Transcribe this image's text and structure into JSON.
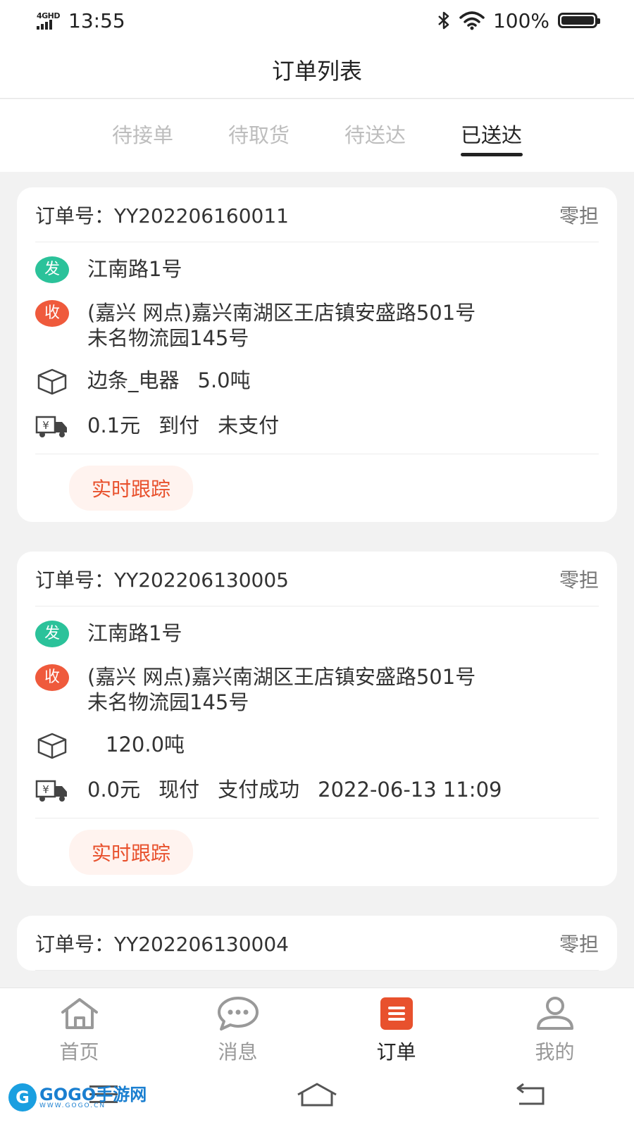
{
  "status_bar": {
    "network": "4GHD",
    "time": "13:55",
    "battery": "100%",
    "icons": [
      "bluetooth-icon",
      "wifi-icon",
      "battery-icon"
    ]
  },
  "header": {
    "title": "订单列表"
  },
  "tabs": [
    {
      "label": "待接单",
      "active": false
    },
    {
      "label": "待取货",
      "active": false
    },
    {
      "label": "待送达",
      "active": false
    },
    {
      "label": "已送达",
      "active": true
    }
  ],
  "orders": [
    {
      "order_no": "订单号：YY202206160011",
      "type": "零担",
      "send_badge": "发",
      "send_addr": "江南路1号",
      "recv_badge": "收",
      "recv_addr_line1": "(嘉兴 网点)嘉兴南湖区王店镇安盛路501号",
      "recv_addr_line2": "未名物流园145号",
      "cargo_name": "边条_电器",
      "cargo_weight": "5.0吨",
      "fee": "0.1元",
      "pay_method": "到付",
      "pay_status": "未支付",
      "pay_time": "",
      "track_label": "实时跟踪"
    },
    {
      "order_no": "订单号：YY202206130005",
      "type": "零担",
      "send_badge": "发",
      "send_addr": "江南路1号",
      "recv_badge": "收",
      "recv_addr_line1": "(嘉兴 网点)嘉兴南湖区王店镇安盛路501号",
      "recv_addr_line2": "未名物流园145号",
      "cargo_name": "",
      "cargo_weight": "120.0吨",
      "fee": "0.0元",
      "pay_method": "现付",
      "pay_status": "支付成功",
      "pay_time": "2022-06-13 11:09",
      "track_label": "实时跟踪"
    },
    {
      "order_no": "订单号：YY202206130004",
      "type": "零担"
    }
  ],
  "bottom_nav": [
    {
      "label": "首页",
      "icon": "home-icon",
      "active": false
    },
    {
      "label": "消息",
      "icon": "message-icon",
      "active": false
    },
    {
      "label": "订单",
      "icon": "order-icon",
      "active": true
    },
    {
      "label": "我的",
      "icon": "profile-icon",
      "active": false
    }
  ],
  "watermark": {
    "main": "GOGO手游网",
    "sub": "WWW.GOGO.CN",
    "letter": "G"
  },
  "colors": {
    "send_badge": "#2bc29a",
    "recv_badge": "#ef5a3c",
    "accent": "#e8512d",
    "track_bg": "#fff3ef"
  }
}
